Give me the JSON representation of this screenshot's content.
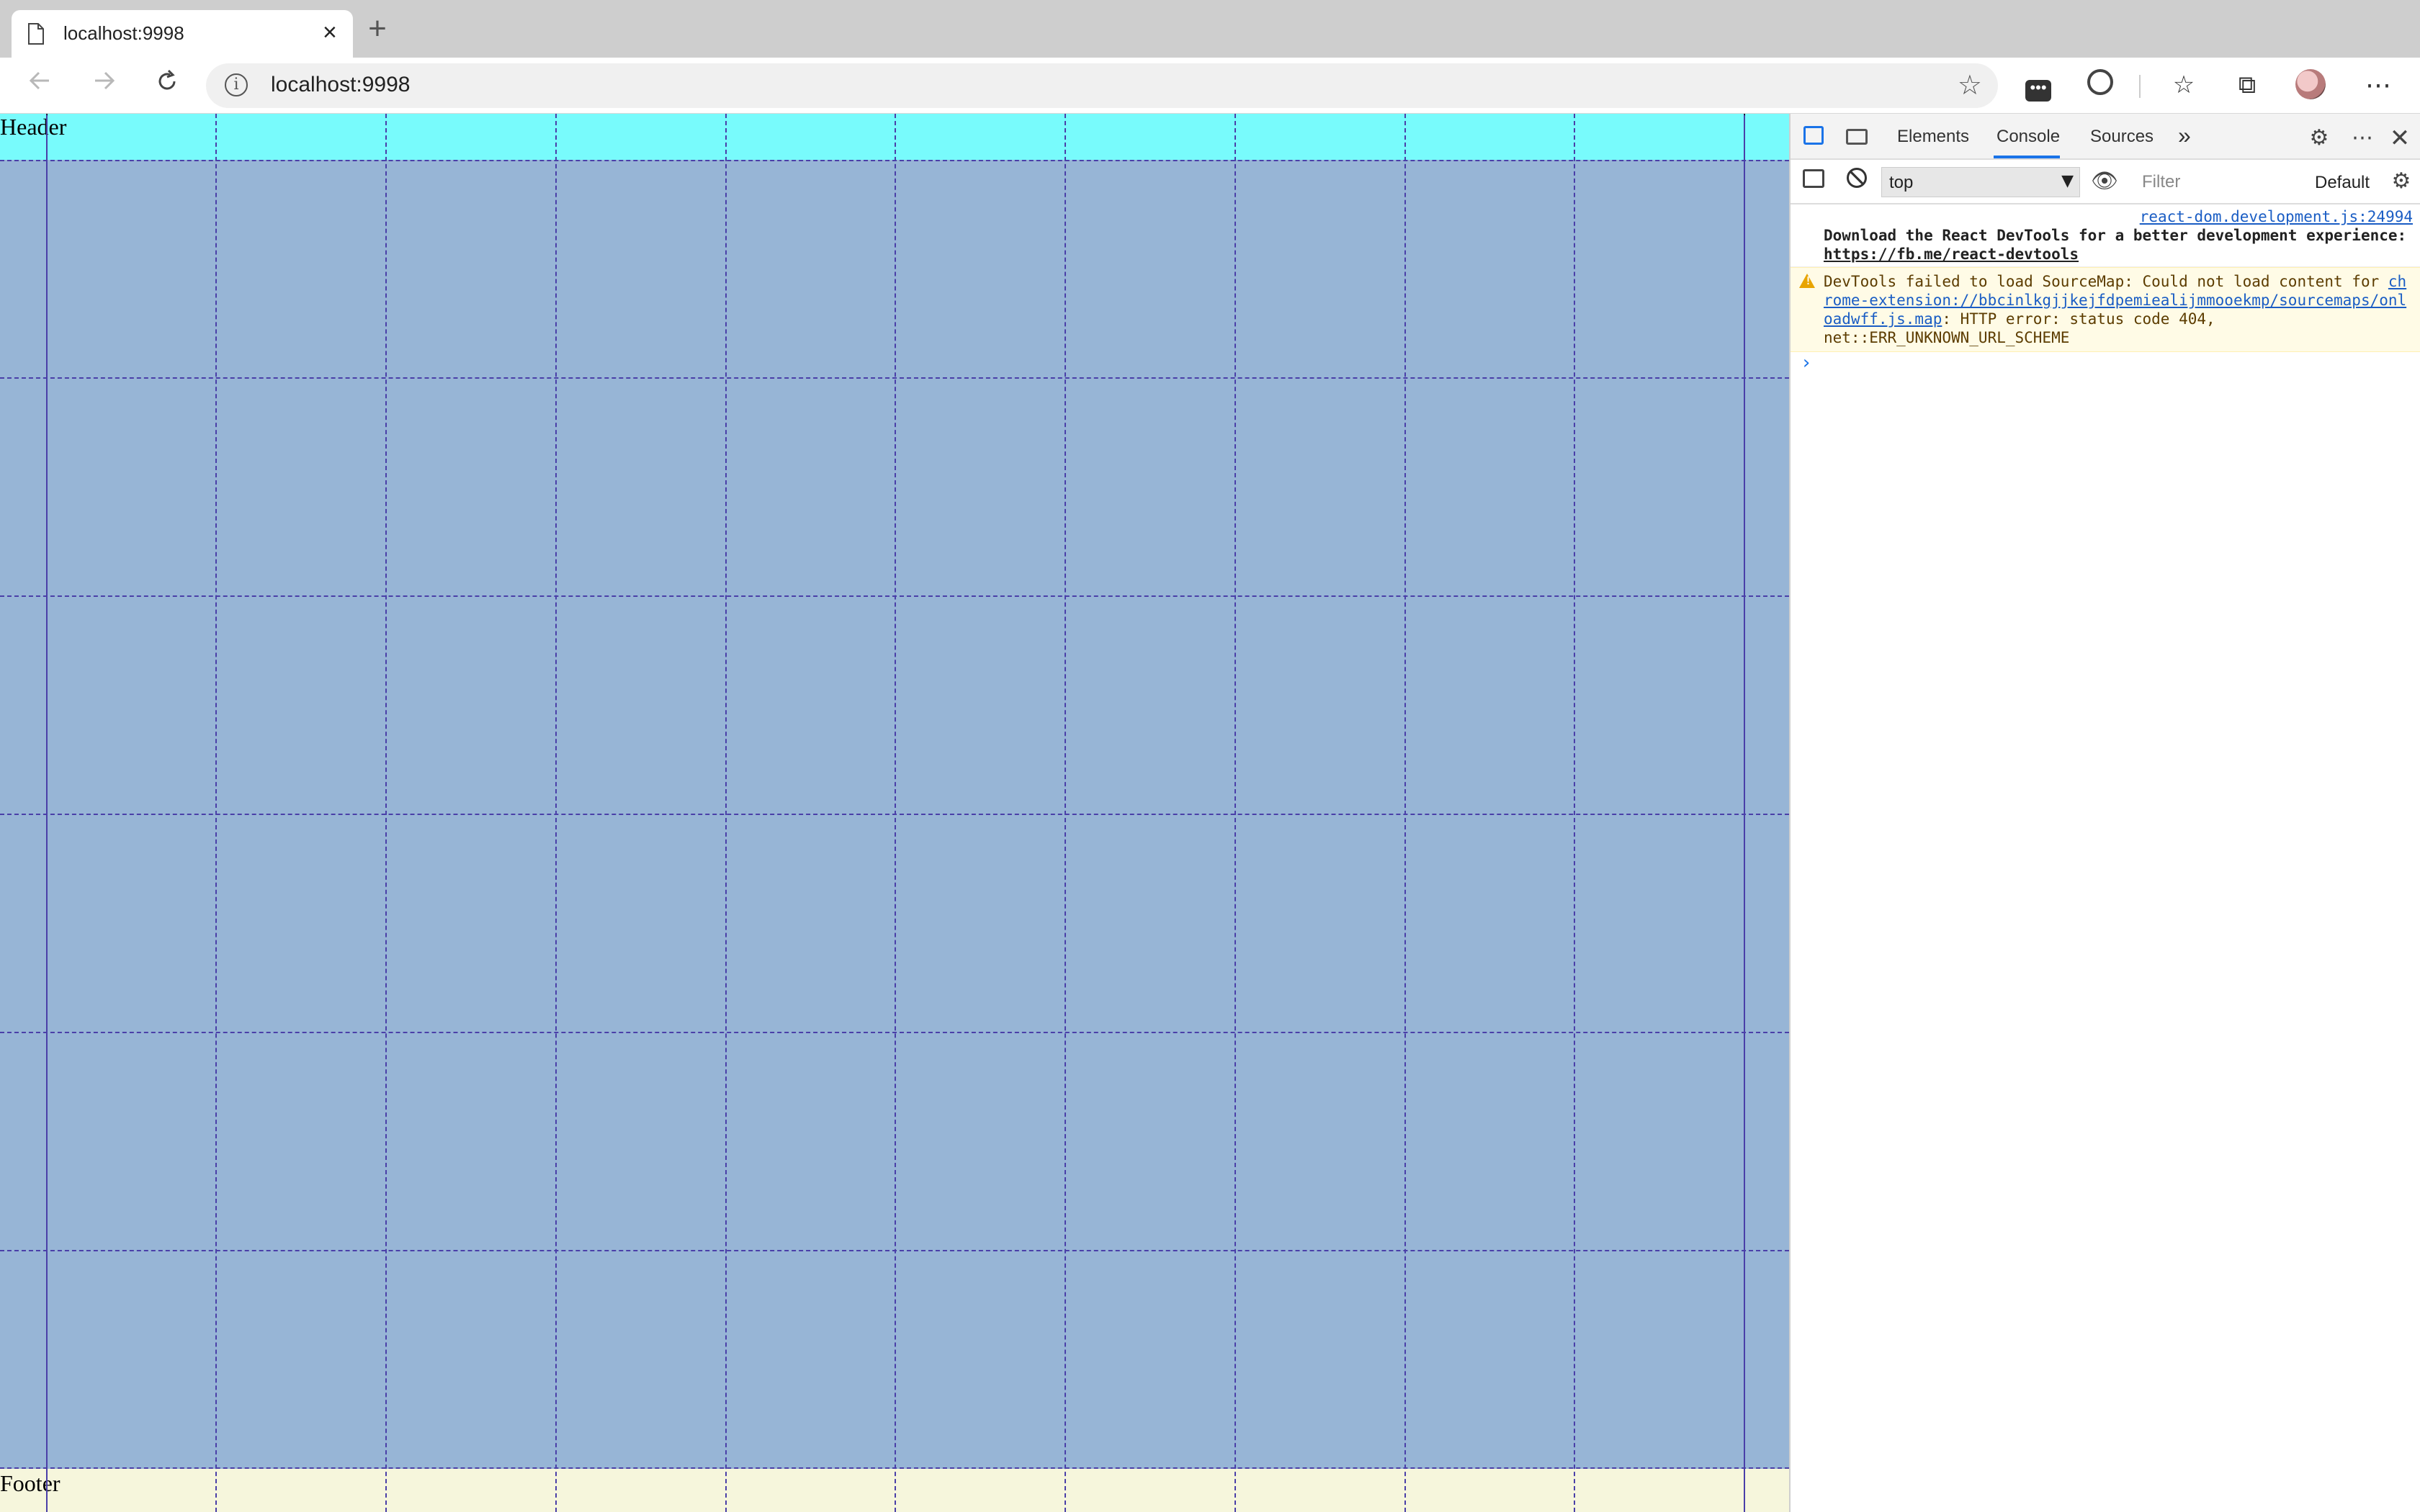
{
  "browser": {
    "tab_title": "localhost:9998",
    "tab_close": "×",
    "new_tab": "+",
    "url": "localhost:9998",
    "icons": {
      "back": "arrow-left",
      "forward": "arrow-right",
      "reload": "reload",
      "info": "info",
      "star": "star",
      "more": "ellipsis"
    }
  },
  "page": {
    "header_label": "Header",
    "footer_label": "Footer",
    "colors": {
      "header": "#78fbfc",
      "body": "#97b5d6",
      "footer": "#f6f6dc",
      "gridline": "#4a3fa8"
    }
  },
  "devtools": {
    "tabs": {
      "elements": "Elements",
      "console": "Console",
      "sources": "Sources",
      "more": "»"
    },
    "context": "top",
    "filter_placeholder": "Filter",
    "levels": "Default",
    "messages": [
      {
        "source": "react-dom.development.js:24994",
        "text": "Download the React DevTools for a better development experience: ",
        "link": "https://fb.me/react-devtools"
      },
      {
        "level": "warning",
        "text_before": "DevTools failed to load SourceMap: Could not load content for ",
        "link": "chrome-extension://bbcinlkgjjkejfdpemiealijmmooekmp/sourcemaps/onloadwff.js.map",
        "text_after": ": HTTP error: status code 404, net::ERR_UNKNOWN_URL_SCHEME"
      }
    ],
    "prompt": "›"
  }
}
